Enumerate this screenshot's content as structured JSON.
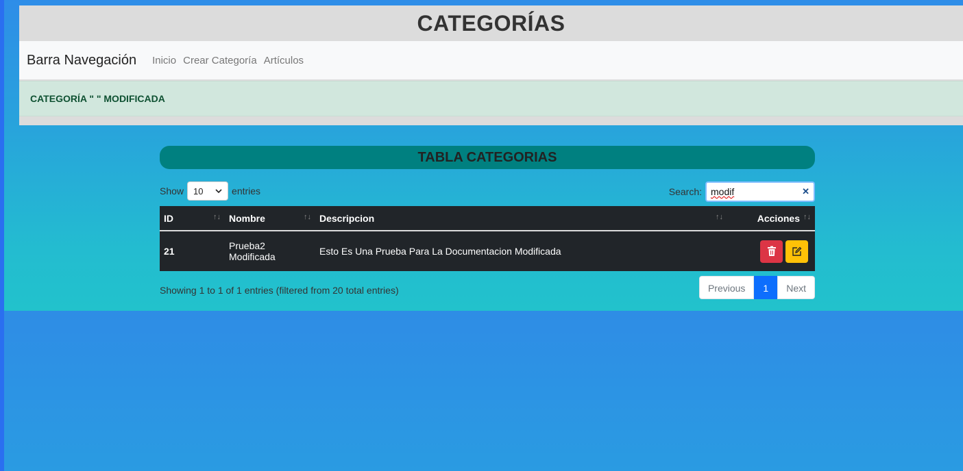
{
  "header": {
    "title": "CATEGORÍAS"
  },
  "navbar": {
    "brand": "Barra Navegación",
    "links": [
      "Inicio",
      "Crear Categoría",
      "Artículos"
    ]
  },
  "alert": {
    "message": "CATEGORÍA \" \" MODIFICADA"
  },
  "table_section": {
    "title": "TABLA CATEGORIAS",
    "show_label": "Show",
    "entries_label": "entries",
    "page_size": "10",
    "search_label": "Search:",
    "search_value": "modif",
    "columns": [
      "ID",
      "Nombre",
      "Descripcion",
      "Acciones"
    ],
    "rows": [
      {
        "id": "21",
        "nombre_line1": "Prueba2",
        "nombre_line2": "Modificada",
        "descripcion": "Esto Es Una Prueba Para La Documentacion Modificada"
      }
    ],
    "info": "Showing 1 to 1 of 1 entries (filtered from 20 total entries)",
    "pagination": {
      "previous": "Previous",
      "current": "1",
      "next": "Next"
    }
  },
  "colors": {
    "title_bar": "#008080",
    "delete_button": "#dc3545",
    "edit_button": "#ffc107",
    "alert_bg": "#d1e7dd",
    "page_active": "#0d6efd"
  }
}
